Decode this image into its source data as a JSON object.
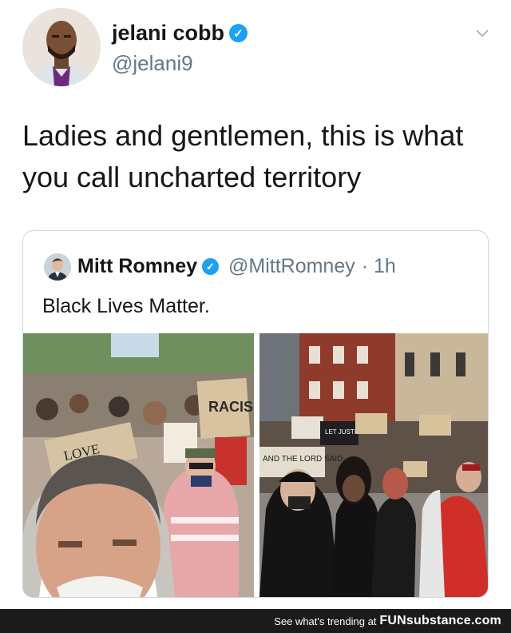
{
  "tweet": {
    "author_name": "jelani cobb",
    "author_handle": "@jelani9",
    "text": "Ladies and gentlemen, this is what you call uncharted territory"
  },
  "quote": {
    "author_name": "Mitt Romney",
    "author_handle": "@MittRomney",
    "time": "· 1h",
    "text": "Black Lives Matter."
  },
  "signs": {
    "racism": "RACISI",
    "love": "LOVE",
    "justice_roll": "LET JUSTICE ROLL",
    "lord": "AND THE LORD SAID"
  },
  "footer": {
    "text": "See what's trending at",
    "brand": "FUNsubstance.com"
  },
  "colors": {
    "verified": "#1da1f2",
    "secondary_text": "#657786",
    "footer_bg": "#1b1b1b"
  },
  "icons": {
    "verified": "verified-badge-icon",
    "caret": "chevron-down-icon"
  }
}
